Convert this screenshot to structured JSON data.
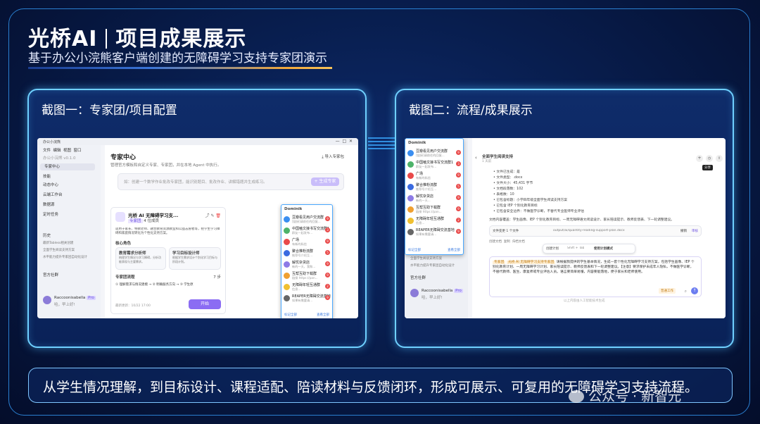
{
  "slide": {
    "title_brand": "光桥AI",
    "title_rest": "项目成果展示",
    "subtitle": "基于办公小浣熊客户端创建的无障碍学习支持专家团演示",
    "caption": "从学生情况理解，到目标设计、课程适配、陪读材料与反馈闭环，形成可展示、可复用的无障碍学习支持流程。",
    "watermark": "公众号 · 新智元"
  },
  "panel1": {
    "title": "截图一：专家团/项目配置",
    "app": {
      "window_title": "办公小浣熊",
      "menu": [
        "文件",
        "编辑",
        "视图",
        "窗口"
      ],
      "version": "办公小浣熊 v0.1.0",
      "sidebar": [
        "专家中心",
        "技能",
        "动态中心",
        "云端工作台",
        "数据源",
        "定时任务",
        "历史",
        "官方社群"
      ],
      "history": [
        "最新Tabless相关创建",
        "全面学生阅读支持方案",
        "水平能力提升专家团自动化设计"
      ],
      "user_name": "Raccoonisabella",
      "user_badge": "Pro",
      "user_status": "哈，早上好!",
      "header_title": "专家中心",
      "header_desc": "管理官方模板和自定义专家、专家团，并在本地 Agent 中执行。",
      "import_label": "导入专家包",
      "create_hint": "如：创建一个数学作业批改专家团，能识别题目、批改作业、讲解错题并生成练习。",
      "create_btn": "+ 生成专家",
      "team_name": "光桥 AI 无障碍学习支...",
      "team_tag": "专家团",
      "team_count": "4 位成员",
      "team_desc": "适用于家长、特教老师、融合教育资源教室和公益志愿者等，把学生学习障碍和家庭情况转化为个性化支持方案。",
      "core_label": "核心角色",
      "roles": [
        {
          "name": "教育需求分析师",
          "desc": "梳理学生情况与学习障碍，分析功能表现与主要需求。"
        },
        {
          "name": "学习目标设计师",
          "desc": "根据学生需求设计个别化学习目标与阶段计划。"
        }
      ],
      "flow_label": "专家团流程",
      "flow_count": "7 步",
      "flow_steps": [
        "理解需求与情况建模",
        "明确服务方向",
        "学生原"
      ],
      "updated": "最新更新：10/22 17:00",
      "start_btn": "开始",
      "popup_user": "Dominik",
      "popup_items": [
        {
          "name": "豆瓣看见用户交流群",
          "msg": "[链接]请前往的回复...",
          "badge": "9"
        },
        {
          "name": "中国嗑文接书写交流群1",
          "msg": "群友一起发布...",
          "badge": "3"
        },
        {
          "name": "广场",
          "msg": "有新的私信",
          "badge": "9"
        },
        {
          "name": "聚合推粉流群",
          "msg": "推荐号介绍互...",
          "badge": "5"
        },
        {
          "name": "解忧杂货店",
          "msg": "新的一天，我和...",
          "badge": "9"
        },
        {
          "name": "互帮互助下载群",
          "msg": "链接 https://pan...",
          "badge": "9"
        },
        {
          "name": "无障碍年轻互通群",
          "msg": "信息...",
          "badge": "2"
        },
        {
          "name": "REAPER无障碍交流基地",
          "msg": "如果有需要请...",
          "badge": "9"
        }
      ],
      "popup_all": "查看全部",
      "popup_read": "标记全部"
    }
  },
  "panel2": {
    "title": "截图二：流程/成果展示",
    "app": {
      "doc_title": "全面学生阅读支持",
      "doc_sub": "1 天前",
      "doc_lines": [
        "文件已生成：是",
        "文件类型：.docx",
        "文件大小：45,431 字节",
        "文档段落数：102",
        "表格数：10",
        "已包含标题：小学四年级全面学生阅读支持方案",
        "已包含 IEP 个别化教育目标",
        "已包含安全边界：不做医学诊断，不替代专业医师专业评估"
      ],
      "doc_summary": "文档内容覆盖：学生画像、IEP 个别化教育目标、一周无障碍语文阅读设计、家长陪读提示、教师反馈表、下一轮调整建议。",
      "file_label": "文件变更 1 个文件",
      "file_path": "output/ai/quantity-reading-support-plan.docx",
      "file_undo": "撤销",
      "file_review": "审核",
      "actions": [
        "创建文档",
        "复制",
        "归档文档"
      ],
      "plan_tab1": "创建计划",
      "plan_tab2": "Shift + Tab",
      "plan_tab3": "使用计划模式",
      "tooltip": "分享",
      "chat_tag": "专家团",
      "chat_team": "光桥 AI 无障碍学习支持专家团",
      "chat_text": "请根据我提供的学生基本情况，生成一套个性化无障碍学习支持方案，包括学生画像、IEP 个别化教育计划、一周无障碍学习计划、家长陪读提示、教师反馈表和下一轮调整建议。【注意】要求保护未成年人隐私，不做医学诊断，不替代教师、医生、康复师或专业评估人员。语言要简单易懂，内容要能落地，便于家长和老师使用。",
      "chat_chip": "普通工作",
      "chat_footer": "以上内容由人工智能技术生成",
      "popup_user": "Dominik",
      "popup_items": [
        {
          "name": "豆瓣看见用户交流群",
          "msg": "[链接]请前往的回复...",
          "badge": "9"
        },
        {
          "name": "中国嗑文接书写交流群1",
          "msg": "群友一起发布...",
          "badge": "3"
        },
        {
          "name": "广场",
          "msg": "有新的私信",
          "badge": "9"
        },
        {
          "name": "聚合推粉流群",
          "msg": "推荐号介绍互...",
          "badge": "5"
        },
        {
          "name": "解忧杂货店",
          "msg": "新的一天...",
          "badge": "9"
        },
        {
          "name": "互帮互助下载群",
          "msg": "链接 https://pan...",
          "badge": "9"
        },
        {
          "name": "无障碍年轻互通群",
          "msg": "信息...",
          "badge": "2"
        },
        {
          "name": "REAPER无障碍交流基地",
          "msg": "如果有需要请...",
          "badge": "9"
        }
      ],
      "popup_all": "查看全部",
      "popup_read": "标记全部"
    }
  }
}
